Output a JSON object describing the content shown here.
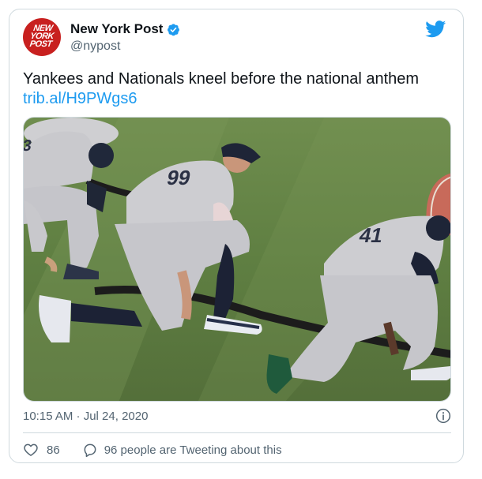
{
  "account": {
    "display_name": "New York Post",
    "handle": "@nypost",
    "avatar_text": "NEW YORK POST",
    "verified": true
  },
  "tweet": {
    "text": "Yankees and Nationals kneel before the national anthem",
    "link": "trib.al/H9PWgs6"
  },
  "media": {
    "jersey_numbers": [
      "3",
      "99",
      "41"
    ]
  },
  "meta": {
    "timestamp": "10:15 AM · Jul 24, 2020"
  },
  "actions": {
    "like_count": "86",
    "tweeting_text": "96 people are Tweeting about this"
  },
  "colors": {
    "twitter_blue": "#1d9bf0",
    "text_secondary": "#536471",
    "avatar_red": "#c8201f"
  },
  "icons": {
    "verified": "verified-badge-icon",
    "twitter": "twitter-bird-icon",
    "info": "info-icon",
    "like": "heart-icon",
    "reply": "speech-bubble-icon"
  }
}
